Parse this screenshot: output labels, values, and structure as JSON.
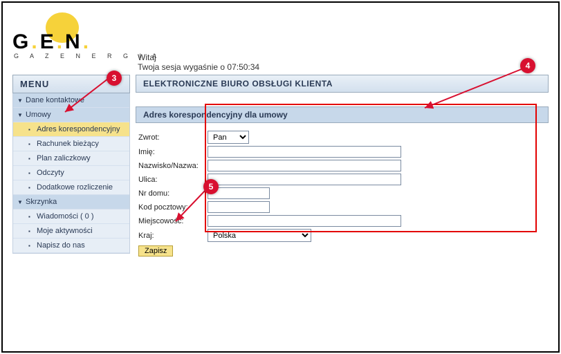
{
  "logo": {
    "main": "G.E.N.",
    "sub": "G A Z   E N E R G I A"
  },
  "header": {
    "greeting": "Witaj",
    "session": "Twoja sesja wygaśnie o 07:50:34"
  },
  "sidebar": {
    "title": "MENU",
    "items": [
      {
        "label": "Dane kontaktowe",
        "type": "group"
      },
      {
        "label": "Umowy",
        "type": "group"
      },
      {
        "label": "Adres korespondencyjny",
        "type": "item",
        "selected": true
      },
      {
        "label": "Rachunek bieżący",
        "type": "item"
      },
      {
        "label": "Plan zaliczkowy",
        "type": "item"
      },
      {
        "label": "Odczyty",
        "type": "item"
      },
      {
        "label": "Dodatkowe rozliczenie",
        "type": "item"
      },
      {
        "label": "Skrzynka",
        "type": "group"
      },
      {
        "label": "Wiadomości ( 0 )",
        "type": "item"
      },
      {
        "label": "Moje aktywności",
        "type": "item"
      },
      {
        "label": "Napisz do nas",
        "type": "item"
      }
    ]
  },
  "main": {
    "title": "ELEKTRONICZNE BIURO OBSŁUGI KLIENTA",
    "section": "Adres korespondencyjny dla umowy",
    "fields": {
      "zwrot_label": "Zwrot:",
      "zwrot_value": "Pan",
      "imie_label": "Imię:",
      "imie_value": "",
      "nazwisko_label": "Nazwisko/Nazwa:",
      "nazwisko_value": "",
      "ulica_label": "Ulica:",
      "ulica_value": "",
      "nrdomu_label": "Nr domu:",
      "nrdomu_value": "",
      "kod_label": "Kod pocztowy:",
      "kod_value": "",
      "miejsc_label": "Miejscowość:",
      "miejsc_value": "",
      "kraj_label": "Kraj:",
      "kraj_value": "Polska"
    },
    "save": "Zapisz"
  },
  "markers": {
    "m3": "3",
    "m4": "4",
    "m5": "5"
  }
}
